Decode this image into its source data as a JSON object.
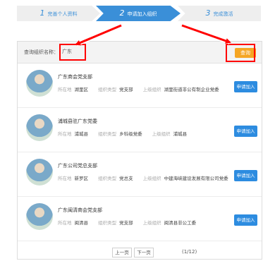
{
  "steps": [
    {
      "num": "1",
      "label": "完善个人资料"
    },
    {
      "num": "2",
      "label": "申请加入组织"
    },
    {
      "num": "3",
      "label": "完成激活"
    }
  ],
  "search": {
    "label": "查询组织名称：",
    "value": "广东",
    "button": "查询"
  },
  "orgs": [
    {
      "name": "广东商会党支部",
      "loc_label": "所在地",
      "loc": "湖里区",
      "type_label": "组织类型",
      "type": "党支部",
      "parent_label": "上级组织",
      "parent": "湖里街道非公有制企业党委",
      "apply": "申请加入"
    },
    {
      "name": "浦城县驻广东党委",
      "loc_label": "所在地",
      "loc": "浦城县",
      "type_label": "组织类型",
      "type": "乡科级党委",
      "parent_label": "上级组织",
      "parent": "浦城县",
      "apply": "申请加入"
    },
    {
      "name": "广东公司党总支部",
      "loc_label": "所在地",
      "loc": "新罗区",
      "type_label": "组织类型",
      "type": "党总支",
      "parent_label": "上级组织",
      "parent": "中建海峡建设发展有限公司党委",
      "apply": "申请加入"
    },
    {
      "name": "广东闽清商会党支部",
      "loc_label": "所在地",
      "loc": "闽清县",
      "type_label": "组织类型",
      "type": "党支部",
      "parent_label": "上级组织",
      "parent": "闽清县非公工委",
      "apply": "申请加入"
    }
  ],
  "pager": {
    "prev": "上一页",
    "next": "下一页",
    "info": "(1/12)"
  },
  "colors": {
    "accent": "#3a8fd8",
    "search_button": "#f5a623",
    "apply_button": "#2d8ce0",
    "highlight": "#ff0000"
  }
}
